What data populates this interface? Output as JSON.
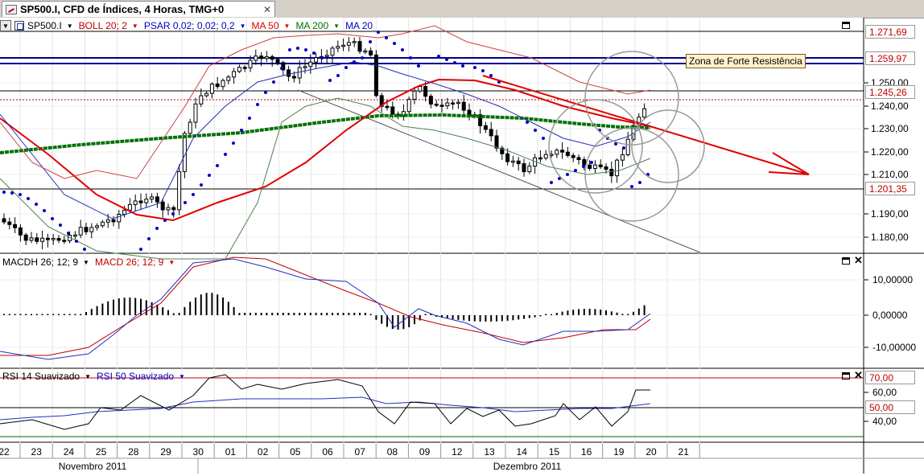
{
  "window": {
    "tab_title": "SP500.I, CFD de Índices, 4 Horas, TMG+0",
    "tab_close": "✕"
  },
  "price_panel": {
    "legend": {
      "symbol": "SP500.I",
      "items": [
        {
          "label": "BOLL 20; 2",
          "color": "#c00000"
        },
        {
          "label": "PSAR 0,02; 0,02; 0,2",
          "color": "#0000c0"
        },
        {
          "label": "MA 50",
          "color": "#e00000"
        },
        {
          "label": "MA 200",
          "color": "#007000"
        },
        {
          "label": "MA 20",
          "color": "#0000c0"
        }
      ]
    },
    "y_ticks": [
      "1.250,00",
      "1.240,00",
      "1.230,00",
      "1.220,00",
      "1.210,00",
      "1.190,00",
      "1.180,00"
    ],
    "price_boxes": [
      "1.271,69",
      "1.259,97",
      "1.245,26",
      "1.201,35"
    ],
    "annotation": "Zona de Forte Resistência"
  },
  "macd_panel": {
    "legend": [
      {
        "label": "MACDH 26; 12; 9",
        "color": "#000000"
      },
      {
        "label": "MACD 26; 12; 9",
        "color": "#c00000"
      }
    ],
    "y_ticks": [
      "10,00000",
      "0,00000",
      "-10,00000"
    ]
  },
  "rsi_panel": {
    "legend": [
      {
        "label": "RSI 14 Suavizado",
        "color": "#000000"
      },
      {
        "label": "RSI 50 Suavizado",
        "color": "#0000c0"
      }
    ],
    "y_ticks": [
      "60,00",
      "40,00"
    ],
    "level_boxes": [
      "70,00",
      "50,00"
    ]
  },
  "x_axis": {
    "days": [
      "22",
      "23",
      "24",
      "25",
      "28",
      "29",
      "30",
      "01",
      "02",
      "05",
      "06",
      "07",
      "08",
      "09",
      "12",
      "13",
      "14",
      "15",
      "16",
      "19",
      "20",
      "21"
    ],
    "months": [
      "Novembro 2011",
      "Dezembro 2011"
    ]
  },
  "colors": {
    "ma50": "#e00000",
    "ma200": "#007000",
    "boll": "#d04040",
    "psar": "#0000c0",
    "trend_arrow": "#e00000",
    "resistance": "#00008b"
  }
}
